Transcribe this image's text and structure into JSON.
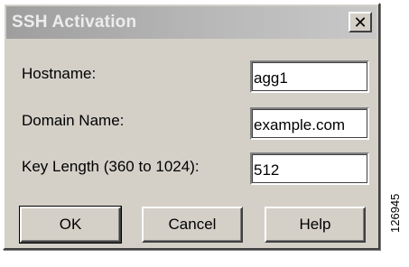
{
  "dialog": {
    "title": "SSH Activation",
    "close_symbol": "✕",
    "fields": [
      {
        "label": "Hostname:",
        "value": "agg1"
      },
      {
        "label": "Domain Name:",
        "value": "example.com"
      },
      {
        "label": "Key Length (360 to 1024):",
        "value": "512"
      }
    ],
    "buttons": {
      "ok": "OK",
      "cancel": "Cancel",
      "help": "Help"
    }
  },
  "figure_number": "126945",
  "icons": {
    "close": "close-icon"
  },
  "colors": {
    "dialog_bg": "#d4d0c8",
    "title_bar": "#9e9e9e",
    "title_text": "#ececec",
    "field_bg": "#ffffff"
  }
}
